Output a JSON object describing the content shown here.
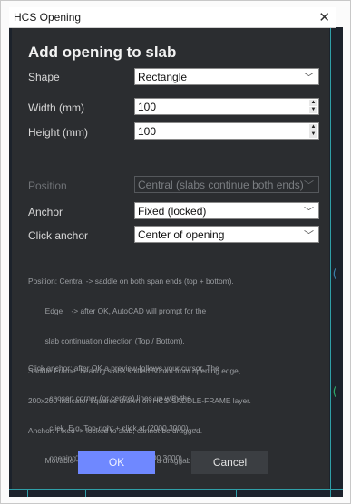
{
  "window": {
    "title": "HCS Opening",
    "close_glyph": "✕"
  },
  "dialog": {
    "heading": "Add opening to slab",
    "shape": {
      "label": "Shape",
      "value": "Rectangle"
    },
    "width": {
      "label": "Width (mm)",
      "value": "100"
    },
    "height": {
      "label": "Height (mm)",
      "value": "100"
    },
    "position": {
      "label": "Position",
      "value": "Central (slabs continue both ends)",
      "enabled": false
    },
    "anchor": {
      "label": "Anchor",
      "value": "Fixed (locked)"
    },
    "click_anchor": {
      "label": "Click anchor",
      "value": "Center of opening"
    },
    "help_text_1": [
      "Position: Central -> saddle on both span ends (top + bottom).",
      "        Edge    -> after OK, AutoCAD will prompt for the",
      "        slab continuation direction (Top / Bottom).",
      "Saddle Frame: bearing slabs shifted 50mm from opening edge,",
      "200x200 indicator squares drawn on HCS-SADDLE-FRAME layer.",
      "Anchor: Fixed -> locked to slab; cannot be dragged.",
      "        Movable -> shape lives in MS as a draggable block."
    ],
    "help_text_2": [
      "Click anchor: after OK a preview follows your cursor. The",
      "          chosen corner (or centre) lines up with the",
      "          click. E.g. Top-right + click at (2000,3000) →",
      "          opening's TR corner sits at (2000,3000)."
    ],
    "ok_label": "OK",
    "cancel_label": "Cancel"
  },
  "icons": {
    "dropdown": "chevron-down-icon",
    "spinner": "spinner-arrows-icon",
    "close": "close-icon"
  },
  "colors": {
    "dialog_bg": "#2b2d30",
    "ok_accent": "#6f88ff",
    "cad_background": "#1c222b"
  }
}
